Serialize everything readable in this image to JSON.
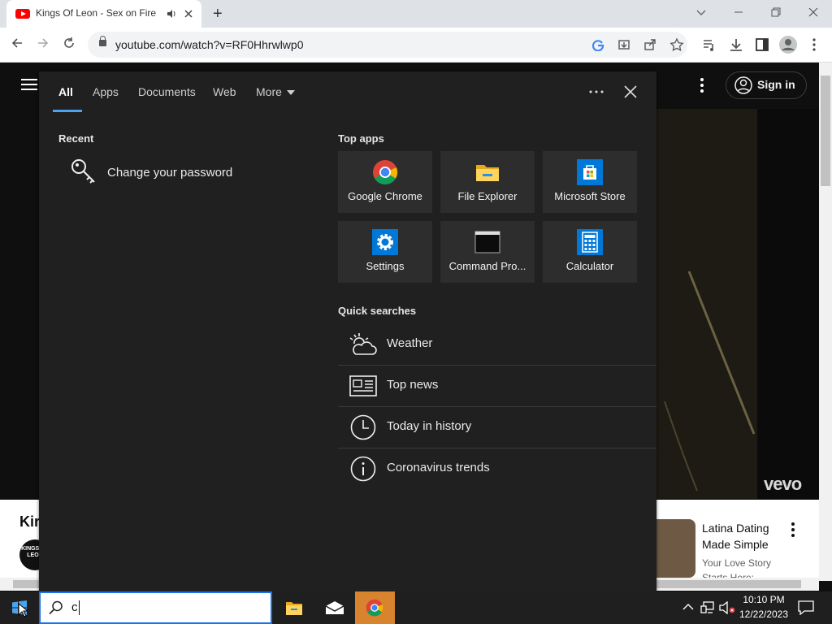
{
  "browser": {
    "tab_title": "Kings Of Leon - Sex on Fire (",
    "new_tab": "+",
    "url": "youtube.com/watch?v=RF0Hhrwlwp0"
  },
  "youtube": {
    "sign_in": "Sign in",
    "vevo": "vevo",
    "video_title_partial": "Kir",
    "channel_avatar_text": "KINGS OF LEON",
    "ad_title": "Latina Dating Made Simple",
    "ad_sub": "Your Love Story Starts Here:"
  },
  "search_panel": {
    "tabs": [
      "All",
      "Apps",
      "Documents",
      "Web",
      "More"
    ],
    "more_label": "More",
    "recent_heading": "Recent",
    "recent_item": "Change your password",
    "top_apps_heading": "Top apps",
    "top_apps": [
      {
        "label": "Google Chrome",
        "icon": "chrome-icon"
      },
      {
        "label": "File Explorer",
        "icon": "folder-icon"
      },
      {
        "label": "Microsoft Store",
        "icon": "store-icon"
      },
      {
        "label": "Settings",
        "icon": "gear-icon"
      },
      {
        "label": "Command Pro...",
        "icon": "terminal-icon"
      },
      {
        "label": "Calculator",
        "icon": "calculator-icon"
      }
    ],
    "quick_heading": "Quick searches",
    "quick": [
      {
        "label": "Weather",
        "icon": "weather-icon"
      },
      {
        "label": "Top news",
        "icon": "news-icon"
      },
      {
        "label": "Today in history",
        "icon": "clock-icon"
      },
      {
        "label": "Coronavirus trends",
        "icon": "info-icon"
      }
    ]
  },
  "taskbar": {
    "search_value": "c",
    "time": "10:10 PM",
    "date": "12/22/2023"
  },
  "colors": {
    "accent": "#4ba3f3",
    "panel_bg": "#202020",
    "tile_bg": "#2d2d2d"
  }
}
